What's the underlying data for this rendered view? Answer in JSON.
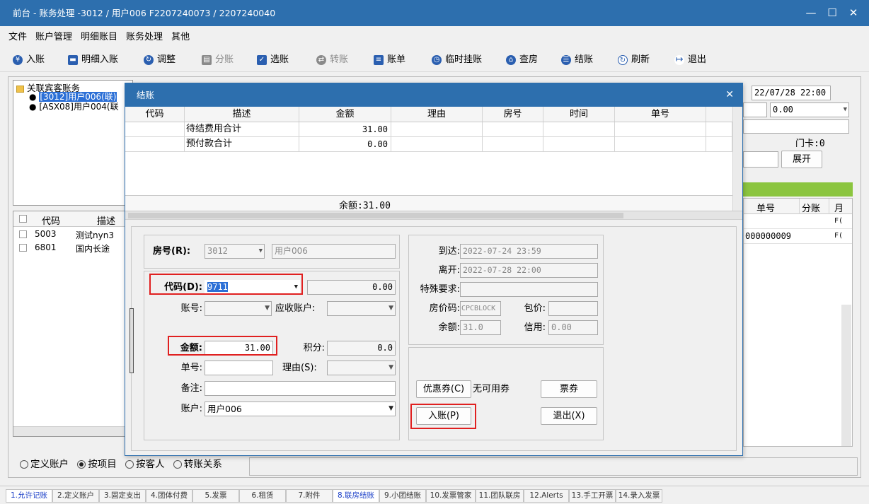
{
  "window": {
    "title": "前台 - 账务处理 -3012 / 用户006  F2207240073 / 2207240040",
    "min_icon": "minimize-icon",
    "max_icon": "maximize-icon",
    "close_icon": "close-icon"
  },
  "menu": [
    "文件",
    "账户管理",
    "明细账目",
    "账务处理",
    "其他"
  ],
  "toolbar": [
    {
      "label": "入账",
      "icon": "yen-icon",
      "color": "#2b5fb0",
      "enabled": true
    },
    {
      "label": "明细入账",
      "icon": "card-icon",
      "color": "#2b5fb0",
      "enabled": true
    },
    {
      "label": "调整",
      "icon": "adjust-icon",
      "color": "#2b5fb0",
      "enabled": true
    },
    {
      "label": "分账",
      "icon": "split-icon",
      "color": "#8a8a8a",
      "enabled": false
    },
    {
      "label": "选账",
      "icon": "select-icon",
      "color": "#2b5fb0",
      "enabled": true
    },
    {
      "label": "转账",
      "icon": "transfer-icon",
      "color": "#8a8a8a",
      "enabled": false
    },
    {
      "label": "账单",
      "icon": "bill-icon",
      "color": "#2b5fb0",
      "enabled": true
    },
    {
      "label": "临时挂账",
      "icon": "clock-icon",
      "color": "#2b5fb0",
      "enabled": true
    },
    {
      "label": "查房",
      "icon": "house-icon",
      "color": "#2b5fb0",
      "enabled": true
    },
    {
      "label": "结账",
      "icon": "database-icon",
      "color": "#2b5fb0",
      "enabled": true
    },
    {
      "label": "刷新",
      "icon": "refresh-icon",
      "color": "#2b5fb0",
      "enabled": true
    },
    {
      "label": "退出",
      "icon": "exit-icon",
      "color": "#2b5fb0",
      "enabled": true
    }
  ],
  "tree": {
    "root": "关联宾客账务",
    "items": [
      "[3012]用户006(联)",
      "[ASX08]用户004(联"
    ]
  },
  "left_grid": {
    "headers": [
      "代码",
      "描述"
    ],
    "rows": [
      [
        "5003",
        "测试nyn3"
      ],
      [
        "6801",
        "国内长途"
      ]
    ]
  },
  "radios": {
    "items": [
      "定义账户",
      "按项目",
      "按客人",
      "转账关系"
    ],
    "selected": 1
  },
  "right_bg": {
    "date": "22/07/28 22:00",
    "amount": "0.00",
    "card": "门卡:0",
    "expand": "展开",
    "headers": [
      "单号",
      "分账",
      "月"
    ],
    "rows": [
      [
        "",
        "",
        "F("
      ],
      [
        "000000009",
        "",
        "F("
      ]
    ]
  },
  "dialog": {
    "title": "结账",
    "grid": {
      "headers": [
        "代码",
        "描述",
        "金额",
        "理由",
        "房号",
        "时间",
        "单号"
      ],
      "rows": [
        {
          "code": "",
          "desc": "待结费用合计",
          "amount": "31.00"
        },
        {
          "code": "",
          "desc": "预付款合计",
          "amount": "0.00"
        }
      ],
      "balance": "余额:31.00"
    },
    "form": {
      "room_label": "房号(R):",
      "room": "3012",
      "room_name": "用户006",
      "code_label": "代码(D):",
      "code": "9711",
      "code_amount": "0.00",
      "acct_label": "账号:",
      "ar_label": "应收账户:",
      "amount_label": "金额:",
      "amount": "31.00",
      "points_label": "积分:",
      "points": "0.0",
      "ticket_label": "单号:",
      "reason_label": "理由(S):",
      "remark_label": "备注:",
      "account_label": "账户:",
      "account": "用户006"
    },
    "info": {
      "arrive_label": "到达:",
      "arrive": "2022-07-24 23:59",
      "depart_label": "离开:",
      "depart": "2022-07-28 22:00",
      "special_label": "特殊要求:",
      "rate_label": "房价码:",
      "rate": "CPCBLOCK",
      "pkg_label": "包价:",
      "balance_label": "余额:",
      "balance": "31.0",
      "credit_label": "信用:",
      "credit": "0.00"
    },
    "buttons": {
      "coupon": "优惠券(C)",
      "no_coupon": "无可用券",
      "voucher": "票券",
      "post": "入账(P)",
      "exit": "退出(X)"
    }
  },
  "tabs": [
    "1.允许记账",
    "2.定义账户",
    "3.固定支出",
    "4.团体付费",
    "5.发票",
    "6.租赁",
    "7.附件",
    "8.联房结账",
    "9.小团结账",
    "10.发票管家",
    "11.团队联房",
    "12.Alerts",
    "13.手工开票",
    "14.录入发票"
  ],
  "active_tab": 0,
  "highlight_tab": 7,
  "colors": {
    "titlebar": "#2d6fae",
    "accent_green": "#8bc53f",
    "highlight": "#e02020",
    "active_tab_text": "#1c40c8"
  }
}
